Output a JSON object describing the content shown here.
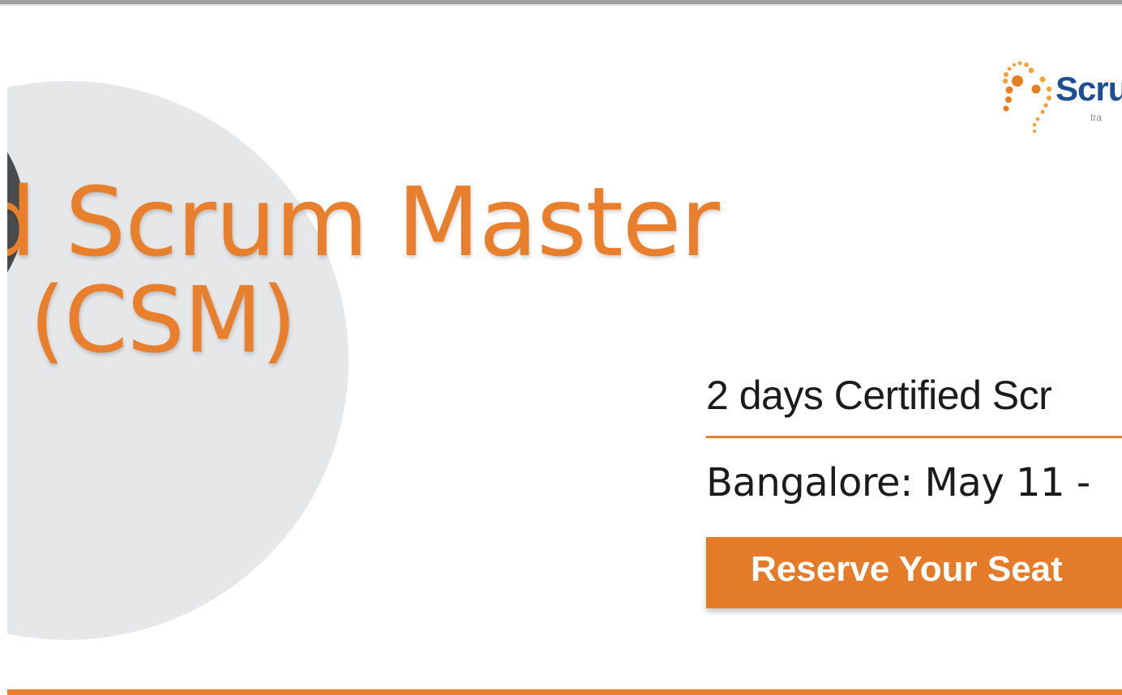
{
  "banner": {
    "title_line_1": "d Scrum Master",
    "title_line_2": "g (CSM)",
    "course_info": "2 days Certified Scr",
    "location_dates": "Bangalore: May 11 -",
    "reserve_button_label": "Reserve Your Seat"
  },
  "logo": {
    "name": "Scru",
    "tagline": "tra"
  },
  "colors": {
    "accent": "#e87f2d",
    "logo_blue": "#1d4f91",
    "circle_gray": "#e6e7e9",
    "dark_gray": "#4a4b4d"
  }
}
